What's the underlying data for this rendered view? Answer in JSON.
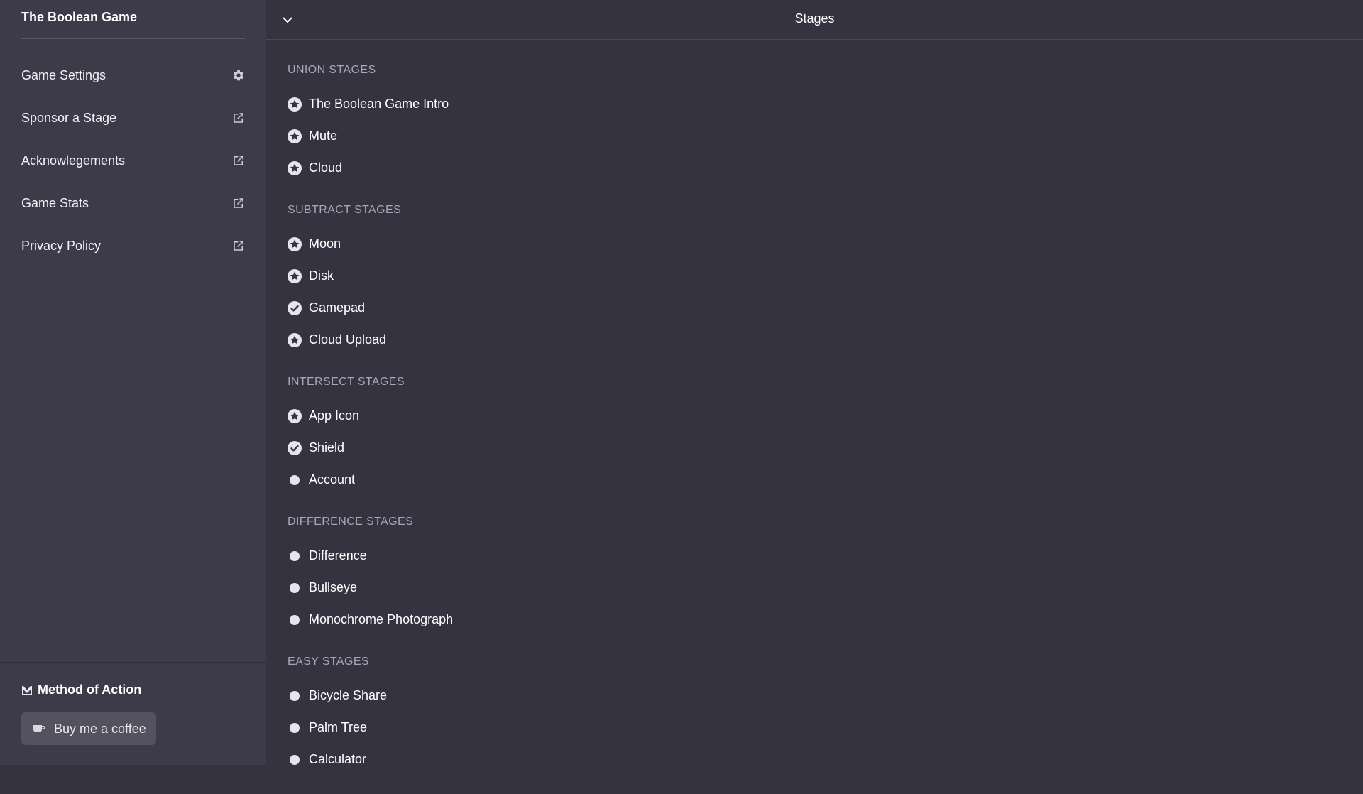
{
  "sidebar": {
    "brand": "The Boolean Game",
    "items": [
      {
        "label": "Game Settings",
        "icon": "gear-icon"
      },
      {
        "label": "Sponsor a Stage",
        "icon": "external-link-icon"
      },
      {
        "label": "Acknowlegements",
        "icon": "external-link-icon"
      },
      {
        "label": "Game Stats",
        "icon": "external-link-icon"
      },
      {
        "label": "Privacy Policy",
        "icon": "external-link-icon"
      }
    ],
    "sponsor": {
      "title": "Method of Action",
      "button_label": "Buy me a coffee"
    }
  },
  "header": {
    "title": "Stages"
  },
  "sections": [
    {
      "title": "UNION STAGES",
      "stages": [
        {
          "label": "The Boolean Game Intro",
          "status": "star"
        },
        {
          "label": "Mute",
          "status": "star"
        },
        {
          "label": "Cloud",
          "status": "star"
        }
      ]
    },
    {
      "title": "SUBTRACT STAGES",
      "stages": [
        {
          "label": "Moon",
          "status": "star"
        },
        {
          "label": "Disk",
          "status": "star"
        },
        {
          "label": "Gamepad",
          "status": "check"
        },
        {
          "label": "Cloud Upload",
          "status": "star"
        }
      ]
    },
    {
      "title": "INTERSECT STAGES",
      "stages": [
        {
          "label": "App Icon",
          "status": "star"
        },
        {
          "label": "Shield",
          "status": "check"
        },
        {
          "label": "Account",
          "status": "dot"
        }
      ]
    },
    {
      "title": "DIFFERENCE STAGES",
      "stages": [
        {
          "label": "Difference",
          "status": "dot"
        },
        {
          "label": "Bullseye",
          "status": "dot"
        },
        {
          "label": "Monochrome Photograph",
          "status": "dot"
        }
      ]
    },
    {
      "title": "EASY STAGES",
      "stages": [
        {
          "label": "Bicycle Share",
          "status": "dot"
        },
        {
          "label": "Palm Tree",
          "status": "dot"
        },
        {
          "label": "Calculator",
          "status": "dot"
        }
      ]
    }
  ],
  "colors": {
    "background": "#353340",
    "sidebar": "#3d3b4a",
    "button": "#55525f"
  }
}
